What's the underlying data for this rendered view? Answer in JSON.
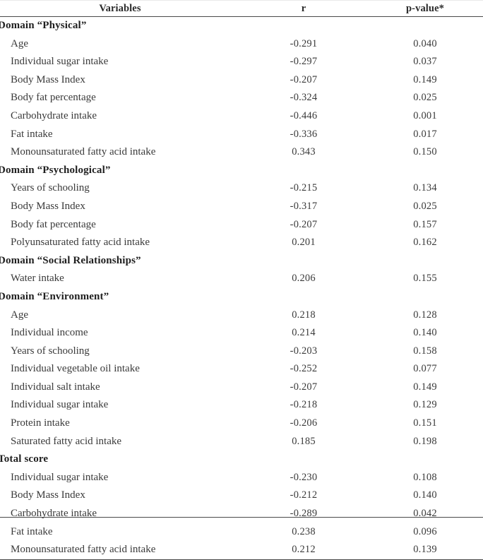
{
  "table": {
    "columns": [
      {
        "key": "variable",
        "label": "Variables",
        "align": "center"
      },
      {
        "key": "r",
        "label": "r",
        "align": "center"
      },
      {
        "key": "p",
        "label": "p-value*",
        "align": "center"
      }
    ],
    "rows": [
      {
        "type": "section",
        "variable": "Domain “Physical”",
        "r": "",
        "p": ""
      },
      {
        "type": "item",
        "variable": "Age",
        "r": "-0.291",
        "p": "0.040"
      },
      {
        "type": "item",
        "variable": "Individual sugar intake",
        "r": "-0.297",
        "p": "0.037"
      },
      {
        "type": "item",
        "variable": "Body Mass Index",
        "r": "-0.207",
        "p": "0.149"
      },
      {
        "type": "item",
        "variable": "Body fat percentage",
        "r": "-0.324",
        "p": "0.025"
      },
      {
        "type": "item",
        "variable": "Carbohydrate intake",
        "r": "-0.446",
        "p": "0.001"
      },
      {
        "type": "item",
        "variable": "Fat intake",
        "r": "-0.336",
        "p": "0.017"
      },
      {
        "type": "item",
        "variable": "Monounsaturated fatty acid intake",
        "r": "0.343",
        "p": "0.150"
      },
      {
        "type": "section",
        "variable": "Domain “Psychological”",
        "r": "",
        "p": ""
      },
      {
        "type": "item",
        "variable": "Years of  schooling",
        "r": "-0.215",
        "p": "0.134"
      },
      {
        "type": "item",
        "variable": "Body Mass Index",
        "r": "-0.317",
        "p": "0.025"
      },
      {
        "type": "item",
        "variable": "Body fat percentage",
        "r": "-0.207",
        "p": "0.157"
      },
      {
        "type": "item",
        "variable": "Polyunsaturated fatty acid intake",
        "r": "0.201",
        "p": "0.162"
      },
      {
        "type": "section",
        "variable": "Domain “Social Relationships”",
        "r": "",
        "p": ""
      },
      {
        "type": "item",
        "variable": "Water intake",
        "r": "0.206",
        "p": "0.155"
      },
      {
        "type": "section",
        "variable": "Domain “Environment”",
        "r": "",
        "p": ""
      },
      {
        "type": "item",
        "variable": "Age",
        "r": "0.218",
        "p": "0.128"
      },
      {
        "type": "item",
        "variable": "Individual income",
        "r": "0.214",
        "p": "0.140"
      },
      {
        "type": "item",
        "variable": "Years of  schooling",
        "r": "-0.203",
        "p": "0.158"
      },
      {
        "type": "item",
        "variable": "Individual vegetable oil intake",
        "r": "-0.252",
        "p": "0.077"
      },
      {
        "type": "item",
        "variable": "Individual salt intake",
        "r": "-0.207",
        "p": "0.149"
      },
      {
        "type": "item",
        "variable": "Individual sugar intake",
        "r": "-0.218",
        "p": "0.129"
      },
      {
        "type": "item",
        "variable": "Protein intake",
        "r": "-0.206",
        "p": "0.151"
      },
      {
        "type": "item",
        "variable": "Saturated fatty acid intake",
        "r": "0.185",
        "p": "0.198"
      },
      {
        "type": "section",
        "variable": "Total score",
        "r": "",
        "p": ""
      },
      {
        "type": "item",
        "variable": "Individual sugar intake",
        "r": "-0.230",
        "p": "0.108"
      },
      {
        "type": "item",
        "variable": "Body Mass Index",
        "r": "-0.212",
        "p": "0.140"
      },
      {
        "type": "item",
        "variable": "Carbohydrate intake",
        "r": "-0.289",
        "p": "0.042"
      },
      {
        "type": "item",
        "variable": "Fat intake",
        "r": "0.238",
        "p": "0.096"
      },
      {
        "type": "item",
        "variable": "Monounsaturated fatty acid intake",
        "r": "0.212",
        "p": "0.139"
      }
    ]
  },
  "style": {
    "rule_color": "#4a4a4a",
    "text_color": "#3a3a3a",
    "heading_color": "#1f1f1f",
    "background": "#ffffff"
  }
}
